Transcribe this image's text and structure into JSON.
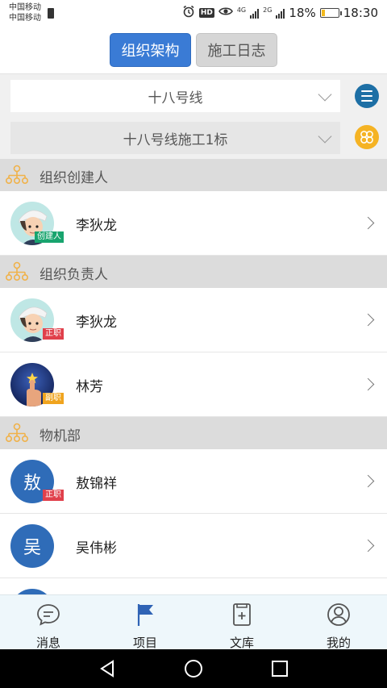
{
  "status_bar": {
    "carrier_1": "中国移动",
    "carrier_2": "中国移动",
    "hd_label": "HD",
    "network_1": "4G",
    "network_2": "2G",
    "battery_percent": "18%",
    "battery_level": 0.18,
    "time": "18:30"
  },
  "tabs": {
    "active": "组织架构",
    "inactive": "施工日志"
  },
  "filters": {
    "line_select": "十八号线",
    "section_select": "十八号线施工1标"
  },
  "groups": [
    {
      "title": "组织创建人",
      "members": [
        {
          "name": "李狄龙",
          "badge": "创建人",
          "avatar": "cartoon-worker"
        }
      ]
    },
    {
      "title": "组织负责人",
      "members": [
        {
          "name": "李狄龙",
          "badge": "正职",
          "avatar": "cartoon-worker"
        },
        {
          "name": "林芳",
          "badge": "副职",
          "avatar": "hand-star"
        }
      ]
    },
    {
      "title": "物机部",
      "members": [
        {
          "name": "敖锦祥",
          "badge": "正职",
          "avatar_text": "敖"
        },
        {
          "name": "吴伟彬",
          "badge": "",
          "avatar_text": "吴"
        }
      ]
    }
  ],
  "bottom_nav": {
    "items": [
      {
        "label": "消息",
        "icon": "chat-icon"
      },
      {
        "label": "项目",
        "icon": "flag-icon"
      },
      {
        "label": "文库",
        "icon": "book-icon"
      },
      {
        "label": "我的",
        "icon": "user-icon"
      }
    ]
  },
  "colors": {
    "accent_blue": "#3a7bd5",
    "menu_button": "#1d6fa5",
    "grid_button": "#f5b324",
    "badge_creator": "#18a46e",
    "badge_primary": "#e0404b",
    "badge_deputy": "#f0a41e",
    "avatar_blue": "#2f6cb8"
  }
}
